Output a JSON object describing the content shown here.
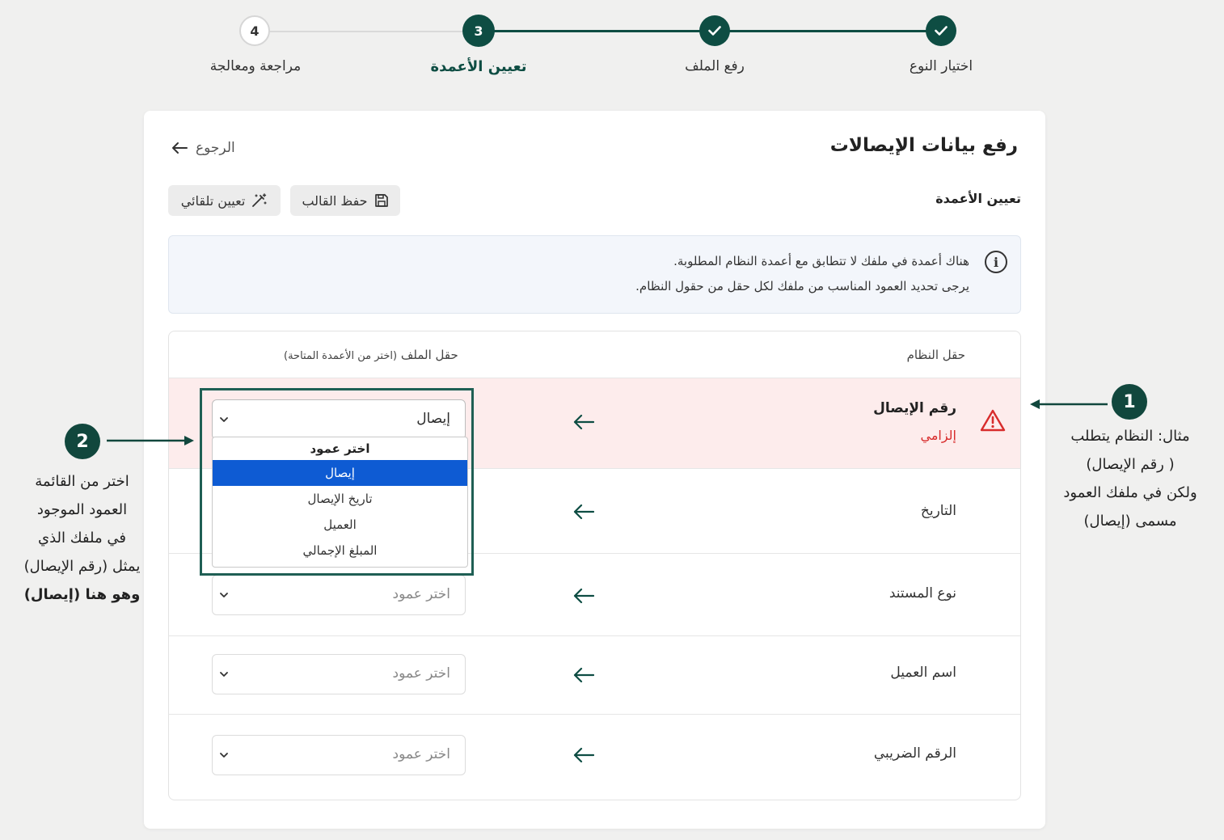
{
  "stepper": {
    "steps": [
      {
        "number": "",
        "label": "اختيار النوع",
        "state": "done"
      },
      {
        "number": "",
        "label": "رفع الملف",
        "state": "done"
      },
      {
        "number": "3",
        "label": "تعيين الأعمدة",
        "state": "active"
      },
      {
        "number": "4",
        "label": "مراجعة ومعالجة",
        "state": "todo"
      }
    ]
  },
  "page": {
    "title": "رفع بيانات الإيصالات",
    "back_label": "الرجوع",
    "section_title": "تعيين الأعمدة"
  },
  "toolbar": {
    "save_template_label": "حفظ القالب",
    "auto_map_label": "تعيين تلقائي"
  },
  "info": {
    "line1": "هناك أعمدة في ملفك لا تتطابق مع أعمدة النظام المطلوبة.",
    "line2": "يرجى تحديد العمود المناسب من ملفك لكل حقل من حقول النظام."
  },
  "table": {
    "header_system": "حقل النظام",
    "header_file": "حقل الملف",
    "header_file_hint": "(اختر من الأعمدة المتاحة)",
    "rows": [
      {
        "system_field": "رقم الإيصال",
        "required_label": "إلزامي",
        "value": "إيصال",
        "placeholder": "اختر عمود",
        "error": true
      },
      {
        "system_field": "التاريخ",
        "value": "",
        "placeholder": "اختر عمود"
      },
      {
        "system_field": "نوع المستند",
        "value": "",
        "placeholder": "اختر عمود"
      },
      {
        "system_field": "اسم العميل",
        "value": "",
        "placeholder": "اختر عمود"
      },
      {
        "system_field": "الرقم الضريبي",
        "value": "",
        "placeholder": "اختر عمود"
      }
    ]
  },
  "dropdown": {
    "header": "اختر عمود",
    "options": [
      "إيصال",
      "تاريخ الإيصال",
      "العميل",
      "المبلغ الإجمالي"
    ],
    "selected": "إيصال"
  },
  "annotations": {
    "badge1": "1",
    "note1": [
      "مثال: النظام يتطلب",
      "( رقم الإيصال)",
      "ولكن في ملفك العمود",
      "مسمى (إيصال)"
    ],
    "badge2": "2",
    "note2": [
      "اختر من القائمة",
      "العمود الموجود",
      "في ملفك الذي",
      "يمثل (رقم الإيصال)",
      "وهو هنا (إيصال)"
    ]
  },
  "colors": {
    "brand": "#0e4d43",
    "error": "#d82c2c",
    "selected_option": "#0e5bd3"
  }
}
